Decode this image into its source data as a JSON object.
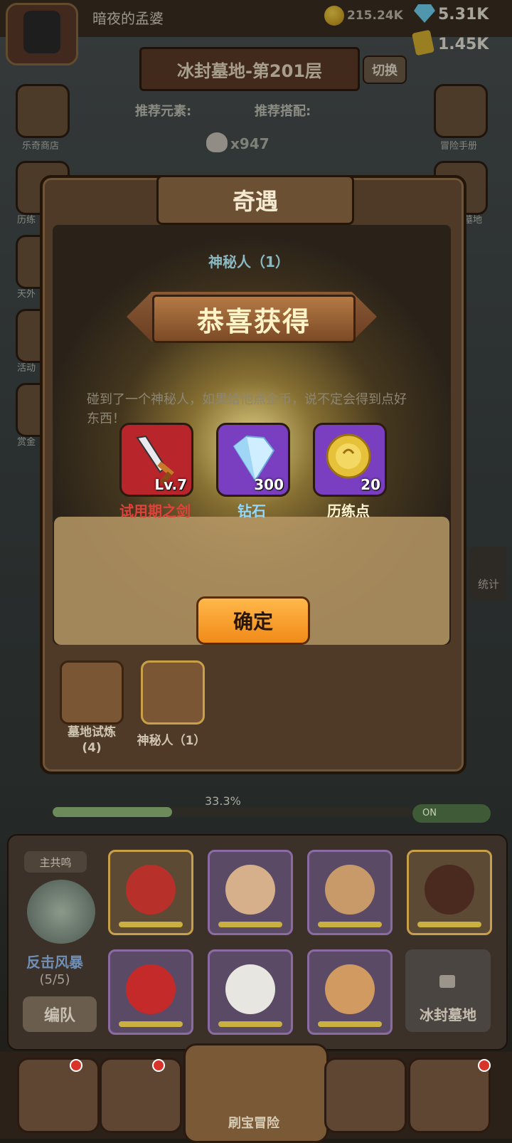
{
  "player": {
    "name": "暗夜的孟婆"
  },
  "currency": {
    "gold": "215.24K",
    "gems": "5.31K",
    "tickets": "1.45K"
  },
  "floor": {
    "title": "冰封墓地-第201层",
    "switch_label": "切换"
  },
  "recommend": {
    "element_label": "推荐元素:",
    "combo_label": "推荐搭配:"
  },
  "kills": {
    "count": "x947"
  },
  "side_left": [
    {
      "label": "乐奇商店",
      "icon": "clover-shop-icon"
    },
    {
      "label": "历练",
      "icon": "trial-icon"
    },
    {
      "label": "天外",
      "icon": "orb-icon"
    },
    {
      "label": "活动",
      "icon": "gift-icon"
    },
    {
      "label": "赏金",
      "icon": "diamond-icon"
    }
  ],
  "side_right": [
    {
      "label": "冒险手册",
      "icon": "scroll-icon"
    },
    {
      "label": "墓地",
      "icon": "tomb-icon"
    },
    {
      "label": "统计",
      "icon": "bar-chart-icon"
    }
  ],
  "dialog": {
    "title": "奇遇",
    "event_name": "神秘人（1）",
    "congrats": "恭喜获得",
    "description": "碰到了一个神秘人，如果给他点金币，说不定会得到点好东西！",
    "rewards": [
      {
        "name": "试用期之剑",
        "count": "Lv.7",
        "icon": "sword-icon",
        "name_color": "#e0423a",
        "bg": "#b8252a"
      },
      {
        "name": "钻石",
        "count": "300",
        "icon": "diamond-icon",
        "name_color": "#8fd8ff",
        "bg": "#7a3ec0"
      },
      {
        "name": "历练点",
        "count": "20",
        "icon": "gold-medal-icon",
        "name_color": "#fff4d0",
        "bg": "#7a3ec0"
      }
    ],
    "confirm_label": "确定",
    "events": [
      {
        "label": "墓地试炼\n(4)",
        "icon": "book-emblem-icon"
      },
      {
        "label": "神秘人（1）",
        "icon": "mystery-emblem-icon"
      }
    ]
  },
  "progress": {
    "percent_text": "33.3%",
    "fraction": 0.333,
    "toggle_label": "ON"
  },
  "team": {
    "resonance_tag": "主共鸣",
    "skill_name": "反击风暴",
    "skill_count": "(5/5)",
    "team_button": "编队",
    "locked_slot": "冰封墓地"
  },
  "nav": {
    "center_label": "刷宝冒险"
  },
  "colors": {
    "accent": "#f5a623",
    "dialog_bg": "#4e3a27"
  }
}
